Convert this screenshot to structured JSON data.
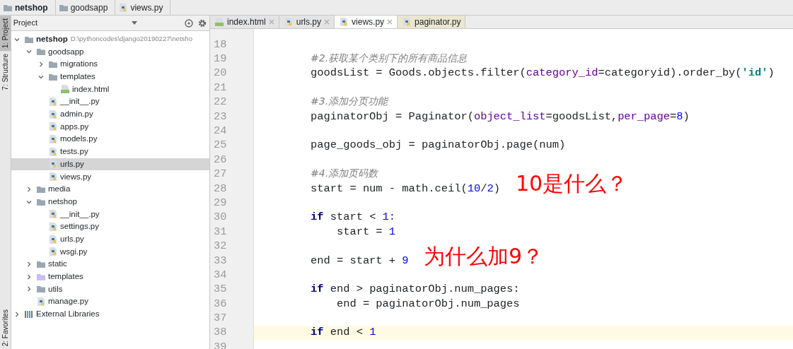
{
  "breadcrumb": [
    {
      "label": "netshop",
      "kind": "folder",
      "bold": true
    },
    {
      "label": "goodsapp",
      "kind": "folder",
      "bold": false
    },
    {
      "label": "views.py",
      "kind": "python",
      "bold": false
    }
  ],
  "tool_strip": [
    {
      "label": "1: Project",
      "selected": true,
      "kind": "project"
    },
    {
      "label": "7: Structure",
      "selected": false,
      "kind": "structure"
    },
    {
      "label": "2: Favorites",
      "selected": false,
      "kind": "favorites"
    }
  ],
  "project_panel": {
    "title": "Project",
    "tree": [
      {
        "label": "netshop",
        "kind": "folder",
        "bold": true,
        "path": "D:\\pythoncodes\\django20190227\\netsho",
        "expanded": true,
        "selected": false,
        "children": [
          {
            "label": "goodsapp",
            "kind": "folder",
            "expanded": true,
            "selected": false,
            "children": [
              {
                "label": "migrations",
                "kind": "folder",
                "expanded": false,
                "selected": false
              },
              {
                "label": "templates",
                "kind": "folder",
                "expanded": true,
                "selected": false,
                "children": [
                  {
                    "label": "index.html",
                    "kind": "html",
                    "selected": false
                  }
                ]
              },
              {
                "label": "__init__.py",
                "kind": "python",
                "selected": false
              },
              {
                "label": "admin.py",
                "kind": "python",
                "selected": false
              },
              {
                "label": "apps.py",
                "kind": "python",
                "selected": false
              },
              {
                "label": "models.py",
                "kind": "python",
                "selected": false
              },
              {
                "label": "tests.py",
                "kind": "python",
                "selected": false
              },
              {
                "label": "urls.py",
                "kind": "python",
                "selected": true
              },
              {
                "label": "views.py",
                "kind": "python",
                "selected": false
              }
            ]
          },
          {
            "label": "media",
            "kind": "folder",
            "expanded": false,
            "selected": false
          },
          {
            "label": "netshop",
            "kind": "folder",
            "expanded": true,
            "selected": false,
            "children": [
              {
                "label": "__init__.py",
                "kind": "python",
                "selected": false
              },
              {
                "label": "settings.py",
                "kind": "python",
                "selected": false
              },
              {
                "label": "urls.py",
                "kind": "python",
                "selected": false
              },
              {
                "label": "wsgi.py",
                "kind": "python",
                "selected": false
              }
            ]
          },
          {
            "label": "static",
            "kind": "folder",
            "expanded": false,
            "selected": false
          },
          {
            "label": "templates",
            "kind": "template-folder",
            "expanded": false,
            "selected": false
          },
          {
            "label": "utils",
            "kind": "folder",
            "expanded": false,
            "selected": false
          },
          {
            "label": "manage.py",
            "kind": "python",
            "selected": false
          }
        ]
      },
      {
        "label": "External Libraries",
        "kind": "library",
        "expanded": false,
        "selected": false
      }
    ]
  },
  "tabs": [
    {
      "label": "index.html",
      "kind": "html",
      "selected": false
    },
    {
      "label": "urls.py",
      "kind": "python",
      "selected": false
    },
    {
      "label": "views.py",
      "kind": "python",
      "selected": true
    },
    {
      "label": "paginator.py",
      "kind": "python",
      "selected": false
    }
  ],
  "code": [
    {
      "number": "18",
      "current": false
    },
    {
      "number": "19",
      "current": false,
      "tokens": [
        {
          "text": "#2.获取某个类别下的所有商品信息",
          "kind": "comment"
        }
      ]
    },
    {
      "number": "20",
      "current": false,
      "tokens": [
        {
          "text": "goodsList = Goods.objects.filter(",
          "kind": "plain"
        },
        {
          "text": "category_id",
          "kind": "param"
        },
        {
          "text": "=categoryid).order_by(",
          "kind": "plain"
        },
        {
          "text": "'id'",
          "kind": "string"
        },
        {
          "text": ")",
          "kind": "plain"
        }
      ]
    },
    {
      "number": "21",
      "current": false
    },
    {
      "number": "22",
      "current": false,
      "tokens": [
        {
          "text": "#3.添加分页功能",
          "kind": "comment"
        }
      ]
    },
    {
      "number": "23",
      "current": false,
      "tokens": [
        {
          "text": "paginatorObj = Paginator(",
          "kind": "plain"
        },
        {
          "text": "object_list",
          "kind": "param"
        },
        {
          "text": "=goodsList,",
          "kind": "plain"
        },
        {
          "text": "per_page",
          "kind": "param"
        },
        {
          "text": "=",
          "kind": "plain"
        },
        {
          "text": "8",
          "kind": "number"
        },
        {
          "text": ")",
          "kind": "plain"
        }
      ]
    },
    {
      "number": "24",
      "current": false
    },
    {
      "number": "25",
      "current": false,
      "tokens": [
        {
          "text": "page_goods_obj = paginatorObj.page(num)",
          "kind": "plain"
        }
      ]
    },
    {
      "number": "26",
      "current": false
    },
    {
      "number": "27",
      "current": false,
      "tokens": [
        {
          "text": "#4.添加页码数",
          "kind": "comment"
        }
      ]
    },
    {
      "number": "28",
      "current": false,
      "tokens": [
        {
          "text": "start = num - math.ceil(",
          "kind": "plain"
        },
        {
          "text": "10",
          "kind": "number"
        },
        {
          "text": "/",
          "kind": "plain"
        },
        {
          "text": "2",
          "kind": "number"
        },
        {
          "text": ")",
          "kind": "plain"
        }
      ]
    },
    {
      "number": "29",
      "current": false
    },
    {
      "number": "30",
      "current": false,
      "tokens": [
        {
          "text": "if",
          "kind": "keyword"
        },
        {
          "text": " start < ",
          "kind": "plain"
        },
        {
          "text": "1",
          "kind": "number"
        },
        {
          "text": ":",
          "kind": "plain"
        }
      ]
    },
    {
      "number": "31",
      "current": false,
      "tokens": [
        {
          "text": "    start = ",
          "kind": "plain"
        },
        {
          "text": "1",
          "kind": "number"
        }
      ]
    },
    {
      "number": "32",
      "current": false
    },
    {
      "number": "33",
      "current": false,
      "tokens": [
        {
          "text": "end = start + ",
          "kind": "plain"
        },
        {
          "text": "9",
          "kind": "number"
        }
      ]
    },
    {
      "number": "34",
      "current": false
    },
    {
      "number": "35",
      "current": false,
      "tokens": [
        {
          "text": "if",
          "kind": "keyword"
        },
        {
          "text": " end > paginatorObj.num_pages:",
          "kind": "plain"
        }
      ]
    },
    {
      "number": "36",
      "current": false,
      "tokens": [
        {
          "text": "    end = paginatorObj.num_pages",
          "kind": "plain"
        }
      ]
    },
    {
      "number": "37",
      "current": false
    },
    {
      "number": "38",
      "current": true,
      "tokens": [
        {
          "text": "if",
          "kind": "keyword"
        },
        {
          "text": " end < ",
          "kind": "plain"
        },
        {
          "text": "1",
          "kind": "number"
        }
      ]
    },
    {
      "number": "39",
      "current": false
    }
  ],
  "annotations": [
    {
      "text": "10是什么？"
    },
    {
      "text": "为什么加9？"
    }
  ]
}
